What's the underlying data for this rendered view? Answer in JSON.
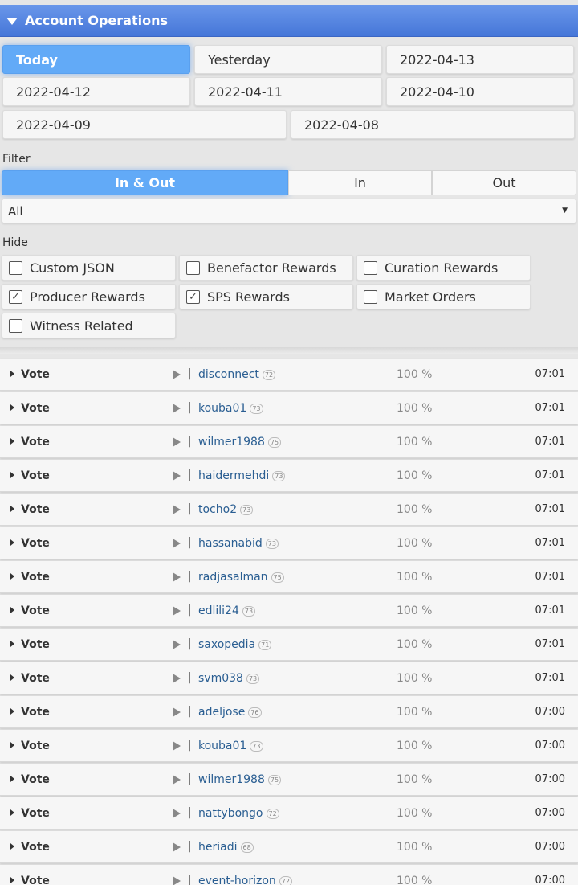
{
  "header": {
    "title": "Account Operations"
  },
  "dates": [
    "Today",
    "Yesterday",
    "2022-04-13",
    "2022-04-12",
    "2022-04-11",
    "2022-04-10",
    "2022-04-09",
    "2022-04-08"
  ],
  "filter": {
    "label": "Filter",
    "segments": [
      "In & Out",
      "In",
      "Out"
    ],
    "select_value": "All"
  },
  "hide": {
    "label": "Hide",
    "options": [
      {
        "label": "Custom JSON",
        "checked": false
      },
      {
        "label": "Benefactor Rewards",
        "checked": false
      },
      {
        "label": "Curation Rewards",
        "checked": false
      },
      {
        "label": "Producer Rewards",
        "checked": true
      },
      {
        "label": "SPS Rewards",
        "checked": true
      },
      {
        "label": "Market Orders",
        "checked": false
      },
      {
        "label": "Witness Related",
        "checked": false
      }
    ]
  },
  "operations": [
    {
      "type": "Vote",
      "user": "disconnect",
      "rep": "72",
      "weight": "100 %",
      "time": "07:01"
    },
    {
      "type": "Vote",
      "user": "kouba01",
      "rep": "73",
      "weight": "100 %",
      "time": "07:01"
    },
    {
      "type": "Vote",
      "user": "wilmer1988",
      "rep": "75",
      "weight": "100 %",
      "time": "07:01"
    },
    {
      "type": "Vote",
      "user": "haidermehdi",
      "rep": "73",
      "weight": "100 %",
      "time": "07:01"
    },
    {
      "type": "Vote",
      "user": "tocho2",
      "rep": "73",
      "weight": "100 %",
      "time": "07:01"
    },
    {
      "type": "Vote",
      "user": "hassanabid",
      "rep": "73",
      "weight": "100 %",
      "time": "07:01"
    },
    {
      "type": "Vote",
      "user": "radjasalman",
      "rep": "75",
      "weight": "100 %",
      "time": "07:01"
    },
    {
      "type": "Vote",
      "user": "edlili24",
      "rep": "73",
      "weight": "100 %",
      "time": "07:01"
    },
    {
      "type": "Vote",
      "user": "saxopedia",
      "rep": "71",
      "weight": "100 %",
      "time": "07:01"
    },
    {
      "type": "Vote",
      "user": "svm038",
      "rep": "73",
      "weight": "100 %",
      "time": "07:01"
    },
    {
      "type": "Vote",
      "user": "adeljose",
      "rep": "76",
      "weight": "100 %",
      "time": "07:00"
    },
    {
      "type": "Vote",
      "user": "kouba01",
      "rep": "73",
      "weight": "100 %",
      "time": "07:00"
    },
    {
      "type": "Vote",
      "user": "wilmer1988",
      "rep": "75",
      "weight": "100 %",
      "time": "07:00"
    },
    {
      "type": "Vote",
      "user": "nattybongo",
      "rep": "72",
      "weight": "100 %",
      "time": "07:00"
    },
    {
      "type": "Vote",
      "user": "heriadi",
      "rep": "68",
      "weight": "100 %",
      "time": "07:00"
    },
    {
      "type": "Vote",
      "user": "event-horizon",
      "rep": "72",
      "weight": "100 %",
      "time": "07:00"
    }
  ]
}
